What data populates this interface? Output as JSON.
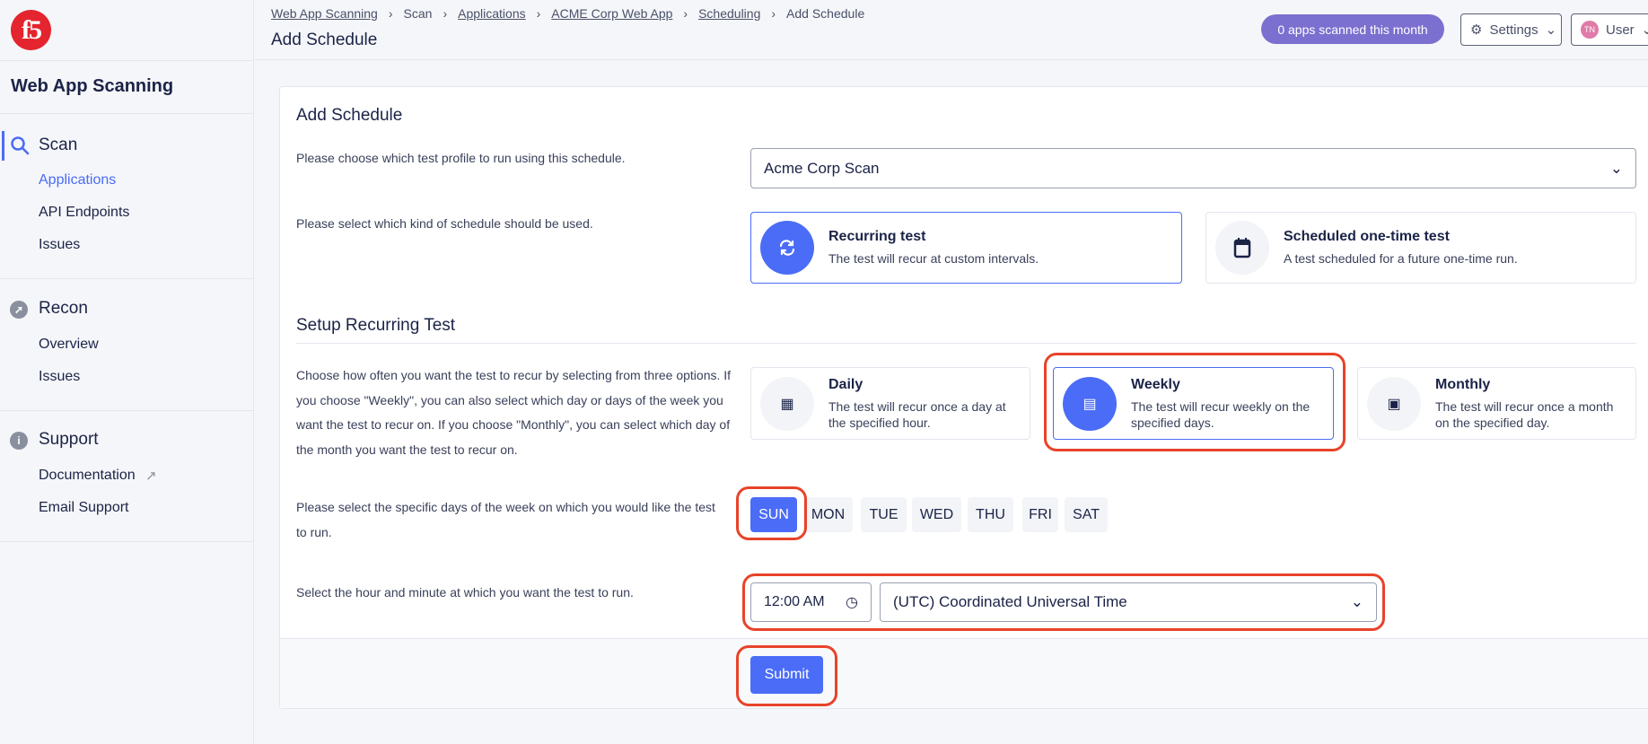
{
  "sidebar": {
    "logo": "f5",
    "title": "Web App Scanning",
    "sections": [
      {
        "label": "Scan",
        "icon": "search-icon",
        "items": [
          "Applications",
          "API Endpoints",
          "Issues"
        ]
      },
      {
        "label": "Recon",
        "icon": "compass-icon",
        "items": [
          "Overview",
          "Issues"
        ]
      },
      {
        "label": "Support",
        "icon": "info-icon",
        "items": [
          "Documentation",
          "Email Support"
        ]
      }
    ]
  },
  "header": {
    "breadcrumb": [
      "Web App Scanning",
      "Scan",
      "Applications",
      "ACME Corp Web App",
      "Scheduling",
      "Add Schedule"
    ],
    "title": "Add Schedule",
    "badge": "0 apps scanned this month",
    "settings": "Settings",
    "user": "User",
    "user_initials": "TN"
  },
  "form": {
    "heading": "Add Schedule",
    "profile_label": "Please choose which test profile to run using this schedule.",
    "profile_value": "Acme Corp Scan",
    "kind_label": "Please select which kind of schedule should be used.",
    "kinds": [
      {
        "title": "Recurring test",
        "desc": "The test will recur at custom intervals.",
        "selected": true
      },
      {
        "title": "Scheduled one-time test",
        "desc": "A test scheduled for a future one-time run.",
        "selected": false
      }
    ],
    "setup_heading": "Setup Recurring Test",
    "freq_label": "Choose how often you want the test to recur by selecting from three options. If you choose \"Weekly\", you can also select which day or days of the week you want the test to recur on. If you choose \"Monthly\", you can select which day of the month you want the test to recur on.",
    "freqs": [
      {
        "title": "Daily",
        "desc": "The test will recur once a day at the specified hour."
      },
      {
        "title": "Weekly",
        "desc": "The test will recur weekly on the specified days."
      },
      {
        "title": "Monthly",
        "desc": "The test will recur once a month on the specified day."
      }
    ],
    "selected_freq": "Weekly",
    "days_label": "Please select the specific days of the week on which you would like the test to run.",
    "days": [
      "SUN",
      "MON",
      "TUE",
      "WED",
      "THU",
      "FRI",
      "SAT"
    ],
    "selected_days": [
      "SUN"
    ],
    "time_label": "Select the hour and minute at which you want the test to run.",
    "time_value": "12:00 AM",
    "timezone": "(UTC) Coordinated Universal Time",
    "submit": "Submit"
  },
  "colors": {
    "accent": "#4a6cf7",
    "badge": "#7b6fcf",
    "annotation": "#e8432a",
    "logo": "#e4242e"
  }
}
